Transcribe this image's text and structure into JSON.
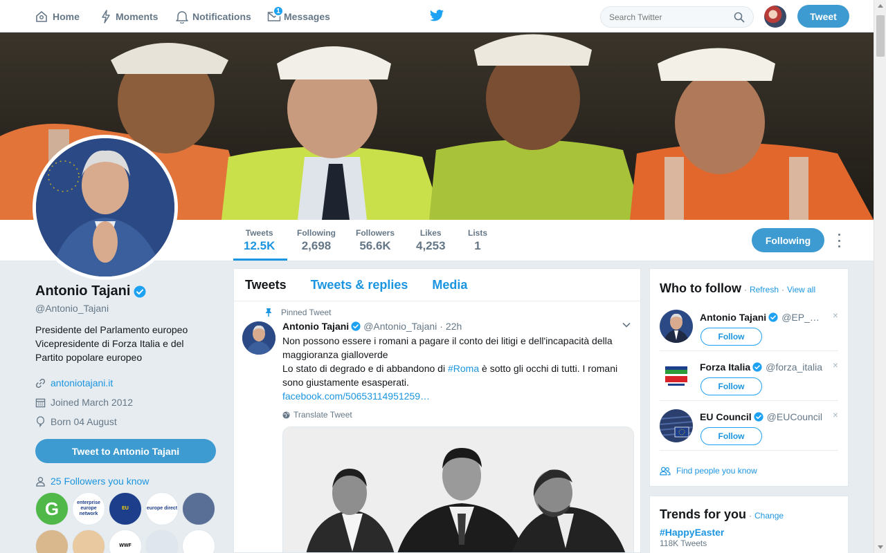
{
  "nav": {
    "home": "Home",
    "moments": "Moments",
    "notifications": "Notifications",
    "messages": "Messages",
    "messages_badge": "1",
    "search_placeholder": "Search Twitter",
    "tweet_button": "Tweet"
  },
  "stats": [
    {
      "label": "Tweets",
      "value": "12.5K"
    },
    {
      "label": "Following",
      "value": "2,698"
    },
    {
      "label": "Followers",
      "value": "56.6K"
    },
    {
      "label": "Likes",
      "value": "4,253"
    },
    {
      "label": "Lists",
      "value": "1"
    }
  ],
  "profile": {
    "name": "Antonio Tajani",
    "handle": "@Antonio_Tajani",
    "bio_lines": [
      "Presidente del Parlamento europeo",
      "Vicepresidente di Forza Italia e del",
      "Partito popolare europeo"
    ],
    "website": "antoniotajani.it",
    "joined": "Joined March 2012",
    "born": "Born 04 August",
    "following_button": "Following",
    "tweet_to_button": "Tweet to Antonio Tajani",
    "followers_you_know": "25 Followers you know"
  },
  "followers_you_know_avatars": [
    {
      "label": "G",
      "bg": "#4fb848",
      "fg": "#ffffff"
    },
    {
      "label": "enterprise europe network",
      "bg": "#ffffff",
      "fg": "#1d3e8a"
    },
    {
      "label": "EU",
      "bg": "#1d3e8a",
      "fg": "#ffd700"
    },
    {
      "label": "europe direct",
      "bg": "#ffffff",
      "fg": "#1d3e8a"
    },
    {
      "label": "",
      "bg": "#5a6f96",
      "fg": "#ffffff"
    },
    {
      "label": "",
      "bg": "#d9b88e",
      "fg": "#ffffff"
    },
    {
      "label": "",
      "bg": "#e8c9a0",
      "fg": "#ffffff"
    },
    {
      "label": "WWF",
      "bg": "#ffffff",
      "fg": "#000000"
    },
    {
      "label": "",
      "bg": "#dfe6ee",
      "fg": "#1d3e8a"
    },
    {
      "label": "",
      "bg": "#ffffff",
      "fg": "#0a6fb8"
    }
  ],
  "tabs": {
    "tweets": "Tweets",
    "tweets_replies": "Tweets & replies",
    "media": "Media"
  },
  "pinned_tweet": {
    "pinned_label": "Pinned Tweet",
    "name": "Antonio Tajani",
    "handle": "@Antonio_Tajani",
    "dot": "·",
    "time": "22h",
    "text_1": "Non possono essere i romani a pagare il conto dei litigi e dell'incapacità della maggioranza gialloverde",
    "text_2a": "Lo stato di degrado e di abbandono di ",
    "hashtag": "#Roma",
    "text_2b": " è sotto gli occhi di tutti. I romani sono giustamente esasperati.",
    "link": "facebook.com/50653114951259…",
    "translate": "Translate Tweet"
  },
  "who_to_follow": {
    "title": "Who to follow",
    "dot": "·",
    "refresh": "Refresh",
    "view_all": "View all",
    "find_people": "Find people you know",
    "suggestions": [
      {
        "name": "Antonio Tajani",
        "handle": "@EP_…",
        "follow": "Follow",
        "close": "×"
      },
      {
        "name": "Forza Italia",
        "handle": "@forza_italia",
        "follow": "Follow",
        "close": "×"
      },
      {
        "name": "EU Council",
        "handle": "@EUCouncil",
        "follow": "Follow",
        "close": "×"
      }
    ]
  },
  "trends": {
    "title": "Trends for you",
    "dot": "·",
    "change": "Change",
    "items": [
      {
        "tag": "#HappyEaster",
        "count": "118K Tweets"
      }
    ]
  },
  "colors": {
    "accent": "#1b95e0",
    "button_bg": "#3d9bd1",
    "muted": "#657786",
    "background": "#e6ecf0"
  }
}
